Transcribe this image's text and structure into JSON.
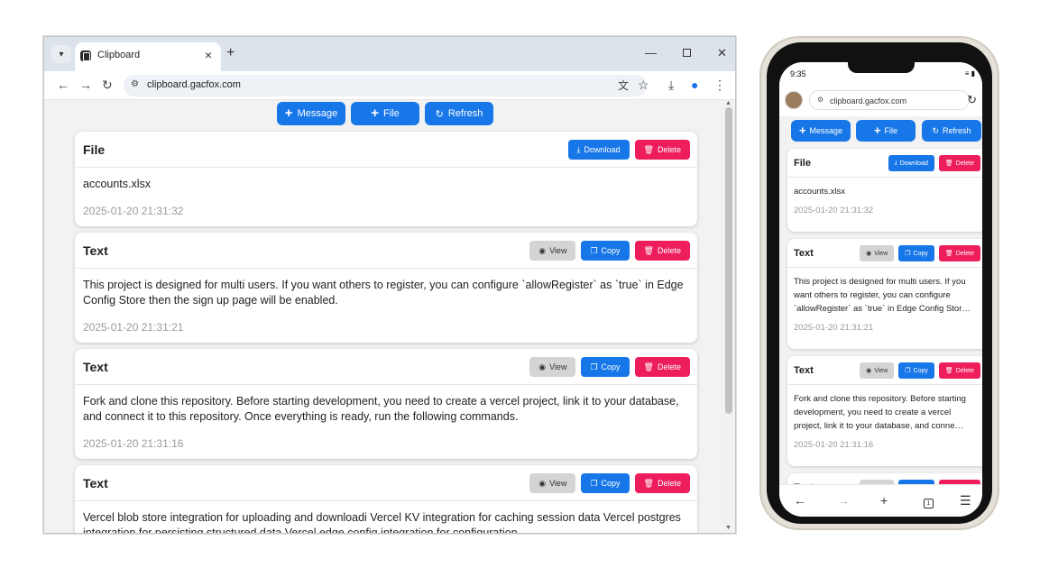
{
  "browser": {
    "tab_title": "Clipboard",
    "url": "clipboard.gacfox.com"
  },
  "actions": {
    "message": "Message",
    "file": "File",
    "refresh": "Refresh"
  },
  "buttons": {
    "view": "View",
    "copy": "Copy",
    "delete": "Delete",
    "download": "Download"
  },
  "items": [
    {
      "type": "File",
      "content": "accounts.xlsx",
      "time": "2025-01-20 21:31:32"
    },
    {
      "type": "Text",
      "content": "This project is designed for multi users. If you want others to register, you can configure `allowRegister` as `true` in Edge Config Store then the sign up page will be enabled.",
      "time": "2025-01-20 21:31:21"
    },
    {
      "type": "Text",
      "content": "Fork and clone this repository. Before starting development, you need to create a vercel project, link it to your database, and connect it to this repository. Once everything is ready, run the following commands.",
      "time": "2025-01-20 21:31:16"
    },
    {
      "type": "Text",
      "content": "Vercel blob store integration for uploading and downloadi Vercel KV integration for caching session data Vercel postgres integration for persisting structured data Vercel edge config integration for configuration",
      "time": ""
    }
  ],
  "phone": {
    "time": "9:35",
    "url": "clipboard.gacfox.com",
    "mobile_items": [
      {
        "type": "File",
        "content": "accounts.xlsx",
        "time": "2025-01-20 21:31:32"
      },
      {
        "type": "Text",
        "content": "This project is designed for multi users. If you want others to register, you can configure `allowRegister` as `true` in Edge Config Stor…",
        "time": "2025-01-20 21:31:21"
      },
      {
        "type": "Text",
        "content": "Fork and clone this repository. Before starting development, you need to create a vercel project, link it to your database, and conne…",
        "time": "2025-01-20 21:31:16"
      },
      {
        "type": "Text",
        "content": "",
        "time": ""
      }
    ],
    "tab_count": "1"
  }
}
